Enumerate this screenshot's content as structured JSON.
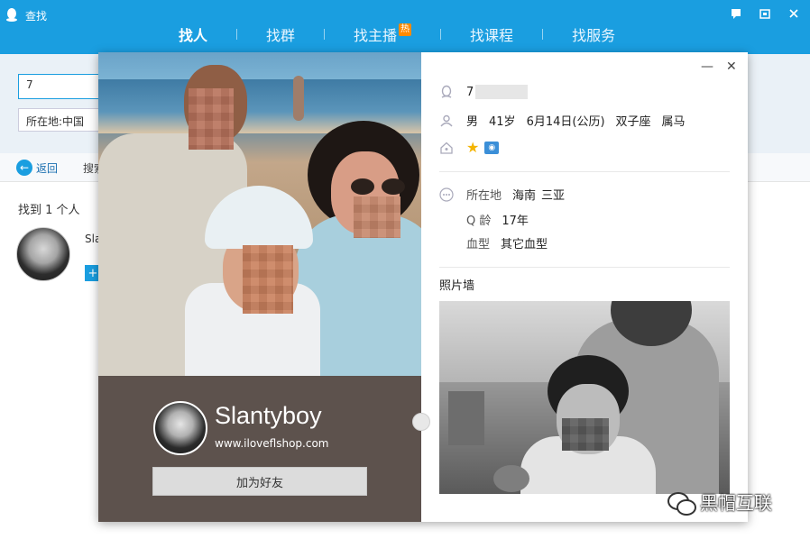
{
  "window": {
    "title": "查找",
    "nav": [
      {
        "label": "找人",
        "active": true
      },
      {
        "label": "找群"
      },
      {
        "label": "找主播",
        "badge": "热"
      },
      {
        "label": "找课程"
      },
      {
        "label": "找服务"
      }
    ],
    "search": {
      "value": "7"
    },
    "location": {
      "value": "所在地:中国"
    },
    "toolbar": {
      "back_label": "返回",
      "find_label": "搜索"
    },
    "result_count": "找到 1 个人",
    "result": {
      "name": "Sla",
      "add_symbol": "+"
    }
  },
  "profile": {
    "nickname": "Slantyboy",
    "website": "www.iloveflshop.com",
    "add_friend_label": "加为好友",
    "qq_number_prefix": "7",
    "gender": "男",
    "age": "41岁",
    "birthday": "6月14日(公历)",
    "zodiac": "双子座",
    "chinese_zodiac": "属马",
    "location_label": "所在地",
    "location_province": "海南",
    "location_city": "三亚",
    "qage_label": "Q 龄",
    "qage": "17年",
    "blood_label": "血型",
    "blood_type": "其它血型",
    "photo_wall_title": "照片墙"
  },
  "watermark": {
    "text": "黑帽互联"
  },
  "colors": {
    "accent": "#1a9ee0",
    "card_left_bg": "#5d524d",
    "hot_badge": "#ff8a00"
  },
  "icons": [
    "qq-penguin-icon",
    "person-icon",
    "house-icon",
    "more-dots-icon",
    "star-icon",
    "camera-icon",
    "back-arrow-icon",
    "close-icon",
    "minimize-icon",
    "wechat-icon"
  ]
}
